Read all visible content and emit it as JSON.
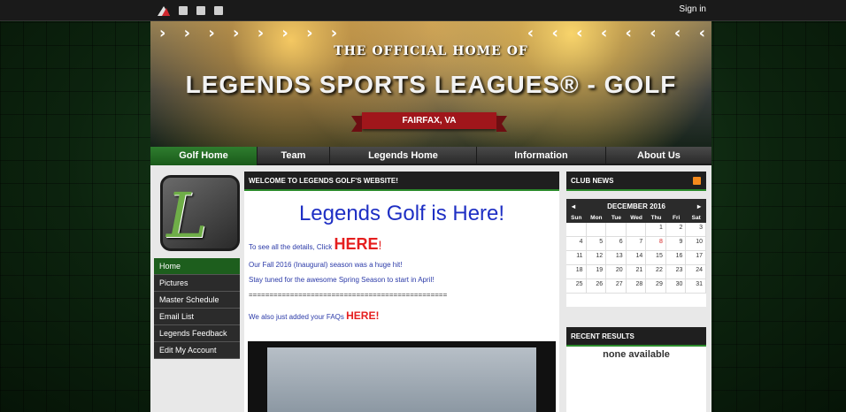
{
  "topbar": {
    "signin": "Sign in",
    "icons": [
      "legends-logo-icon",
      "mail-icon",
      "facebook-icon",
      "twitter-icon"
    ]
  },
  "banner": {
    "subtitle": "THE OFFICIAL HOME OF",
    "title": "LEGENDS SPORTS LEAGUES® - GOLF",
    "location": "FAIRFAX, VA",
    "left_chevrons": "› › › › › › › ›",
    "right_chevrons": "‹ ‹ ‹ ‹ ‹ ‹ ‹ ‹"
  },
  "nav": {
    "items": [
      "Golf Home",
      "Team",
      "Legends Home",
      "Information",
      "About Us"
    ]
  },
  "sidebar": {
    "items": [
      "Home",
      "Pictures",
      "Master Schedule",
      "Email List",
      "Legends Feedback",
      "Edit My Account"
    ]
  },
  "welcome": {
    "heading": "WELCOME TO LEGENDS GOLF'S WEBSITE!",
    "title": "Legends Golf is Here!",
    "line1_prefix": "To see all the details, Click ",
    "line1_link": "HERE",
    "line1_suffix": "!",
    "line2": "Our Fall 2016 (Inaugural) season was a huge hit!",
    "line3": "Stay tuned for the awesome Spring Season to start in April!",
    "divider": "================================================",
    "line4_prefix": "We also just added your FAQs ",
    "line4_link": "HERE!"
  },
  "club_news": {
    "heading": "CLUB NEWS"
  },
  "calendar": {
    "prev": "◂",
    "month": "DECEMBER 2016",
    "next": "▸",
    "dow": [
      "Sun",
      "Mon",
      "Tue",
      "Wed",
      "Thu",
      "Fri",
      "Sat"
    ],
    "days": [
      "",
      "",
      "",
      "",
      "1",
      "2",
      "3",
      "4",
      "5",
      "6",
      "7",
      "8",
      "9",
      "10",
      "11",
      "12",
      "13",
      "14",
      "15",
      "16",
      "17",
      "18",
      "19",
      "20",
      "21",
      "22",
      "23",
      "24",
      "25",
      "26",
      "27",
      "28",
      "29",
      "30",
      "31"
    ],
    "highlight": "8"
  },
  "recent_results": {
    "heading": "RECENT RESULTS",
    "empty": "none available"
  }
}
